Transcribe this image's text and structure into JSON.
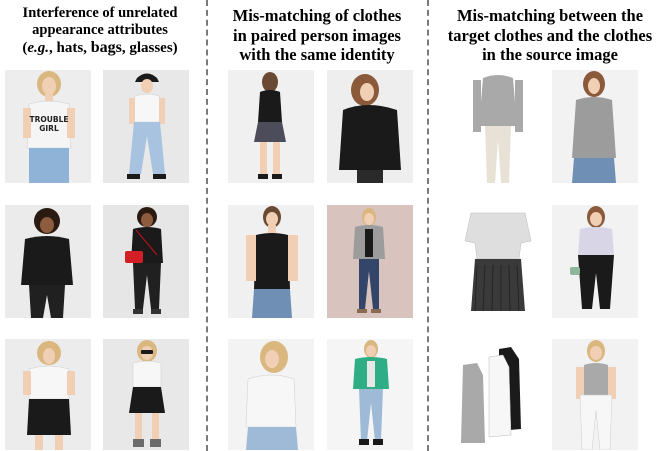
{
  "columns": [
    {
      "title_lines": [
        "Interference of unrelated",
        "appearance attributes",
        "(e.g., hats, bags, glasses)"
      ],
      "title_emph": {
        "italic": "e.g.",
        "bold_words": [
          "hats,",
          "bags,",
          "glasses)"
        ]
      }
    },
    {
      "title_lines": [
        "Mis-matching of clothes",
        "in paired person images",
        "with the same identity"
      ]
    },
    {
      "title_lines": [
        "Mis-matching between the",
        "target clothes and the clothes",
        "in the source image"
      ]
    }
  ],
  "photo_texts": {
    "tshirt_print": [
      "TROUBLE",
      "GIRL"
    ]
  },
  "colors": {
    "divider": "#7a7a7a",
    "photo_bg": "#e9e9e9",
    "skin": "#f0cfb4",
    "hair_blonde": "#d9b77e",
    "hair_dark": "#2a1b12",
    "black": "#1a1a1a",
    "white": "#f7f7f7",
    "denim": "#8fb3d6",
    "grey": "#9c9c9c",
    "red": "#d21f26",
    "green": "#2fae86"
  }
}
